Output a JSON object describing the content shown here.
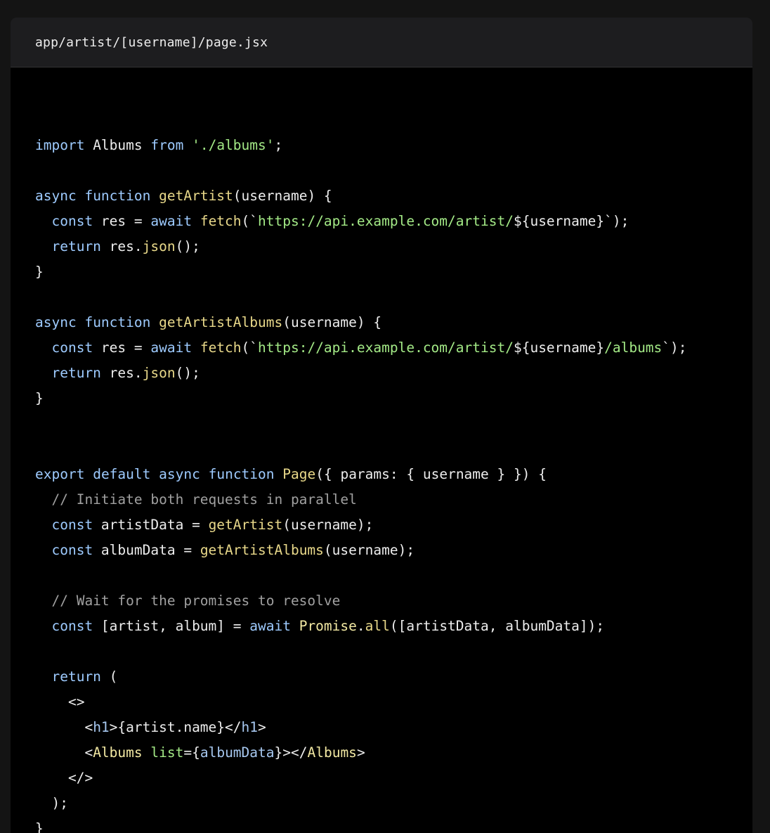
{
  "file": {
    "name": "app/artist/[username]/page.jsx"
  },
  "colors": {
    "keyword": "#9ecbff",
    "function": "#e9d98a",
    "string": "#a3e986",
    "comment": "#a0a0a0",
    "plain": "#ededed",
    "tag": "#a7c8f0",
    "component": "#f3e9a3",
    "attr": "#a3e986"
  },
  "code": {
    "lines": [
      {
        "tokens": [
          {
            "t": "import",
            "c": "keyword"
          },
          {
            "t": " Albums ",
            "c": "plain"
          },
          {
            "t": "from",
            "c": "keyword"
          },
          {
            "t": " ",
            "c": "plain"
          },
          {
            "t": "'./albums'",
            "c": "string"
          },
          {
            "t": ";",
            "c": "plain"
          }
        ]
      },
      {
        "tokens": []
      },
      {
        "tokens": [
          {
            "t": "async",
            "c": "keyword"
          },
          {
            "t": " ",
            "c": "plain"
          },
          {
            "t": "function",
            "c": "keyword"
          },
          {
            "t": " ",
            "c": "plain"
          },
          {
            "t": "getArtist",
            "c": "function"
          },
          {
            "t": "(username) {",
            "c": "plain"
          }
        ]
      },
      {
        "tokens": [
          {
            "t": "  ",
            "c": "plain"
          },
          {
            "t": "const",
            "c": "keyword"
          },
          {
            "t": " res = ",
            "c": "plain"
          },
          {
            "t": "await",
            "c": "keyword"
          },
          {
            "t": " ",
            "c": "plain"
          },
          {
            "t": "fetch",
            "c": "function"
          },
          {
            "t": "(`",
            "c": "plain"
          },
          {
            "t": "https://api.example.com/artist/",
            "c": "string"
          },
          {
            "t": "${username}",
            "c": "plain"
          },
          {
            "t": "`);",
            "c": "plain"
          }
        ]
      },
      {
        "tokens": [
          {
            "t": "  ",
            "c": "plain"
          },
          {
            "t": "return",
            "c": "keyword"
          },
          {
            "t": " res.",
            "c": "plain"
          },
          {
            "t": "json",
            "c": "function"
          },
          {
            "t": "();",
            "c": "plain"
          }
        ]
      },
      {
        "tokens": [
          {
            "t": "}",
            "c": "plain"
          }
        ]
      },
      {
        "tokens": []
      },
      {
        "tokens": [
          {
            "t": "async",
            "c": "keyword"
          },
          {
            "t": " ",
            "c": "plain"
          },
          {
            "t": "function",
            "c": "keyword"
          },
          {
            "t": " ",
            "c": "plain"
          },
          {
            "t": "getArtistAlbums",
            "c": "function"
          },
          {
            "t": "(username) {",
            "c": "plain"
          }
        ]
      },
      {
        "tokens": [
          {
            "t": "  ",
            "c": "plain"
          },
          {
            "t": "const",
            "c": "keyword"
          },
          {
            "t": " res = ",
            "c": "plain"
          },
          {
            "t": "await",
            "c": "keyword"
          },
          {
            "t": " ",
            "c": "plain"
          },
          {
            "t": "fetch",
            "c": "function"
          },
          {
            "t": "(`",
            "c": "plain"
          },
          {
            "t": "https://api.example.com/artist/",
            "c": "string"
          },
          {
            "t": "${username}",
            "c": "plain"
          },
          {
            "t": "/albums",
            "c": "string"
          },
          {
            "t": "`);",
            "c": "plain"
          }
        ]
      },
      {
        "tokens": [
          {
            "t": "  ",
            "c": "plain"
          },
          {
            "t": "return",
            "c": "keyword"
          },
          {
            "t": " res.",
            "c": "plain"
          },
          {
            "t": "json",
            "c": "function"
          },
          {
            "t": "();",
            "c": "plain"
          }
        ]
      },
      {
        "tokens": [
          {
            "t": "}",
            "c": "plain"
          }
        ]
      },
      {
        "tokens": []
      },
      {
        "tokens": []
      },
      {
        "tokens": [
          {
            "t": "export",
            "c": "keyword"
          },
          {
            "t": " ",
            "c": "plain"
          },
          {
            "t": "default",
            "c": "keyword"
          },
          {
            "t": " ",
            "c": "plain"
          },
          {
            "t": "async",
            "c": "keyword"
          },
          {
            "t": " ",
            "c": "plain"
          },
          {
            "t": "function",
            "c": "keyword"
          },
          {
            "t": " ",
            "c": "plain"
          },
          {
            "t": "Page",
            "c": "function"
          },
          {
            "t": "({ params: { username } }) {",
            "c": "plain"
          }
        ]
      },
      {
        "tokens": [
          {
            "t": "  ",
            "c": "plain"
          },
          {
            "t": "// Initiate both requests in parallel",
            "c": "comment"
          }
        ]
      },
      {
        "tokens": [
          {
            "t": "  ",
            "c": "plain"
          },
          {
            "t": "const",
            "c": "keyword"
          },
          {
            "t": " artistData = ",
            "c": "plain"
          },
          {
            "t": "getArtist",
            "c": "function"
          },
          {
            "t": "(username);",
            "c": "plain"
          }
        ]
      },
      {
        "tokens": [
          {
            "t": "  ",
            "c": "plain"
          },
          {
            "t": "const",
            "c": "keyword"
          },
          {
            "t": " albumData = ",
            "c": "plain"
          },
          {
            "t": "getArtistAlbums",
            "c": "function"
          },
          {
            "t": "(username);",
            "c": "plain"
          }
        ]
      },
      {
        "tokens": []
      },
      {
        "tokens": [
          {
            "t": "  ",
            "c": "plain"
          },
          {
            "t": "// Wait for the promises to resolve",
            "c": "comment"
          }
        ]
      },
      {
        "tokens": [
          {
            "t": "  ",
            "c": "plain"
          },
          {
            "t": "const",
            "c": "keyword"
          },
          {
            "t": " [artist, album] = ",
            "c": "plain"
          },
          {
            "t": "await",
            "c": "keyword"
          },
          {
            "t": " ",
            "c": "plain"
          },
          {
            "t": "Promise",
            "c": "component"
          },
          {
            "t": ".",
            "c": "plain"
          },
          {
            "t": "all",
            "c": "function"
          },
          {
            "t": "([artistData, albumData]);",
            "c": "plain"
          }
        ]
      },
      {
        "tokens": []
      },
      {
        "tokens": [
          {
            "t": "  ",
            "c": "plain"
          },
          {
            "t": "return",
            "c": "keyword"
          },
          {
            "t": " (",
            "c": "plain"
          }
        ]
      },
      {
        "tokens": [
          {
            "t": "    <>",
            "c": "plain"
          }
        ]
      },
      {
        "tokens": [
          {
            "t": "      <",
            "c": "plain"
          },
          {
            "t": "h1",
            "c": "tag"
          },
          {
            "t": ">{artist.name}</",
            "c": "plain"
          },
          {
            "t": "h1",
            "c": "tag"
          },
          {
            "t": ">",
            "c": "plain"
          }
        ]
      },
      {
        "tokens": [
          {
            "t": "      <",
            "c": "plain"
          },
          {
            "t": "Albums",
            "c": "component"
          },
          {
            "t": " ",
            "c": "plain"
          },
          {
            "t": "list",
            "c": "attr"
          },
          {
            "t": "={",
            "c": "plain"
          },
          {
            "t": "albumData",
            "c": "tag"
          },
          {
            "t": "}></",
            "c": "plain"
          },
          {
            "t": "Albums",
            "c": "component"
          },
          {
            "t": ">",
            "c": "plain"
          }
        ]
      },
      {
        "tokens": [
          {
            "t": "    </>",
            "c": "plain"
          }
        ]
      },
      {
        "tokens": [
          {
            "t": "  );",
            "c": "plain"
          }
        ]
      },
      {
        "tokens": [
          {
            "t": "}",
            "c": "plain"
          }
        ]
      }
    ]
  }
}
